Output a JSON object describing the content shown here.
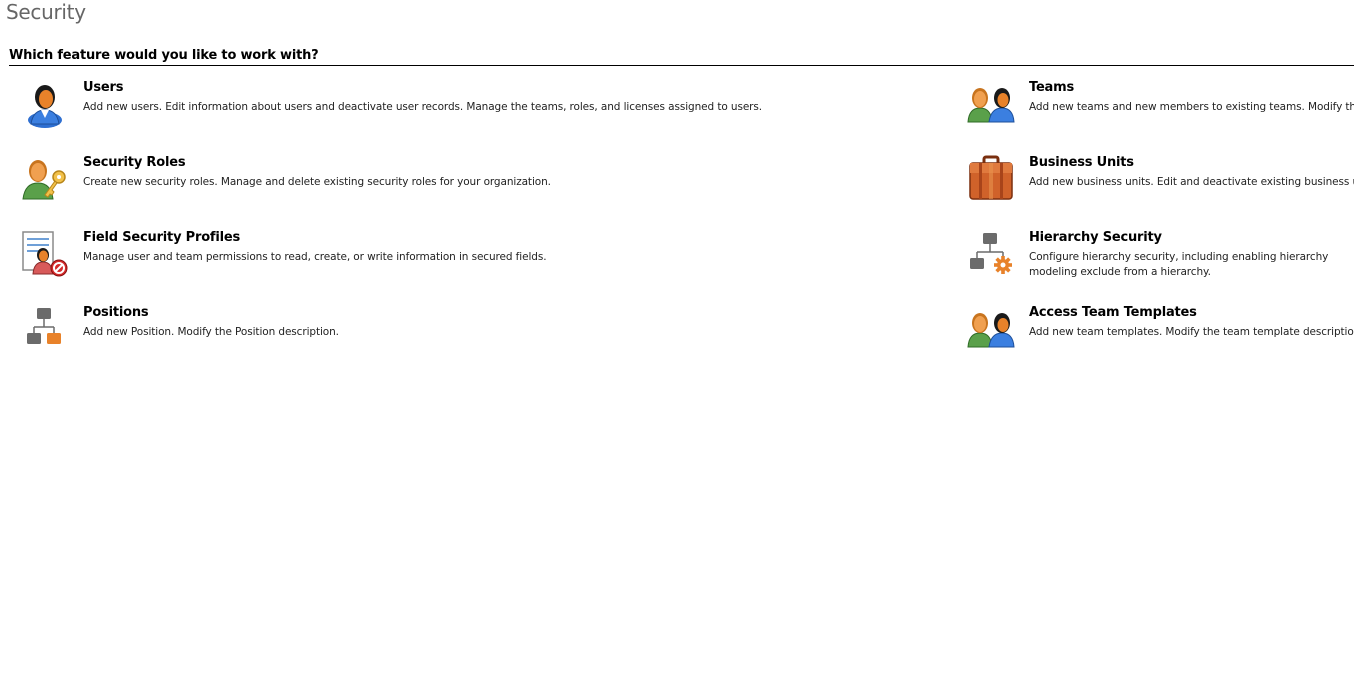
{
  "page": {
    "title": "Security",
    "question": "Which feature would you like to work with?"
  },
  "features": {
    "users": {
      "title": "Users",
      "description": "Add new users. Edit information about users and deactivate user records. Manage the teams, roles, and licenses assigned to users.",
      "icon": "user-icon"
    },
    "teams": {
      "title": "Teams",
      "description": "Add new teams and new members to existing teams. Modify the te",
      "icon": "team-icon"
    },
    "security_roles": {
      "title": "Security Roles",
      "description": "Create new security roles. Manage and delete existing security roles for your organization.",
      "icon": "user-key-icon"
    },
    "business_units": {
      "title": "Business Units",
      "description": "Add new business units. Edit and deactivate existing business units.",
      "icon": "briefcase-icon"
    },
    "field_security_profiles": {
      "title": "Field Security Profiles",
      "description": "Manage user and team permissions to read, create, or write information in secured fields.",
      "icon": "document-user-prohibited-icon"
    },
    "hierarchy_security": {
      "title": "Hierarchy Security",
      "description": "Configure hierarchy security, including enabling hierarchy modeling exclude from a hierarchy.",
      "icon": "hierarchy-gear-icon"
    },
    "positions": {
      "title": "Positions",
      "description": "Add new Position. Modify the Position description.",
      "icon": "org-chart-icon"
    },
    "access_team_templates": {
      "title": "Access Team Templates",
      "description": "Add new team templates. Modify the team template description.",
      "icon": "team-icon"
    }
  },
  "colors": {
    "title_gray": "#666666",
    "person_orange": "#e8822a",
    "person_blue": "#2e6fd1",
    "person_green": "#5aa04a",
    "case_orange": "#c8501c",
    "chart_gray": "#6b6b6b"
  }
}
